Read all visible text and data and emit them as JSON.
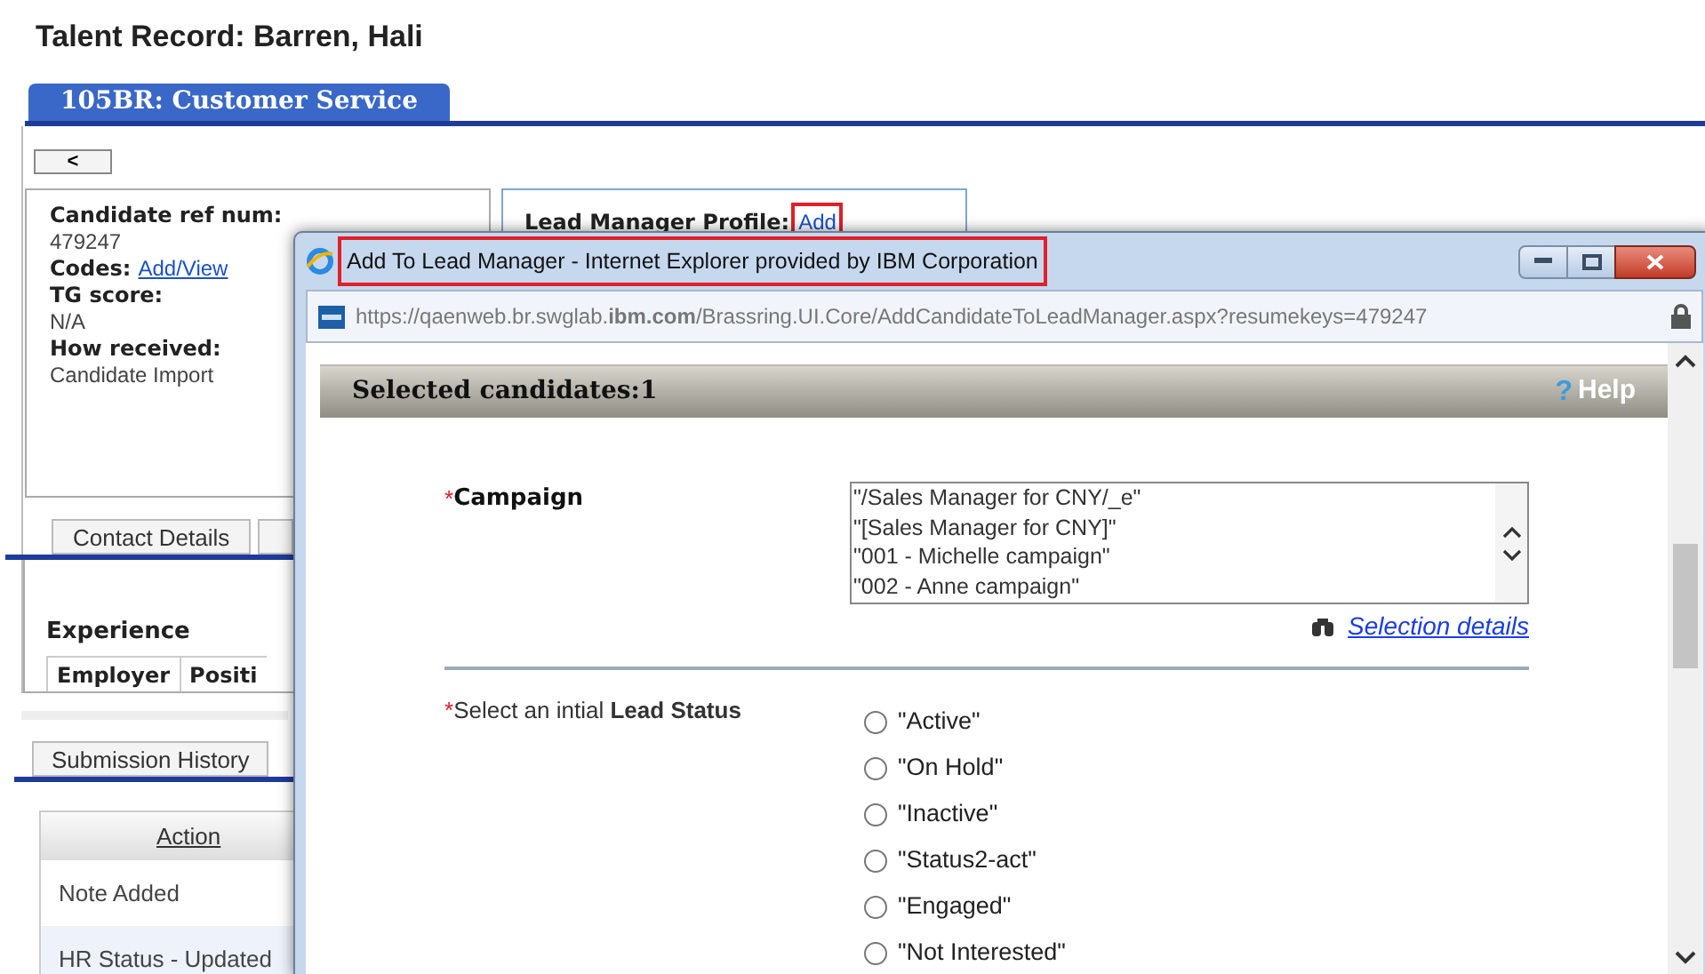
{
  "page_title": "Talent Record: Barren, Hali",
  "record_tabs": [
    {
      "label": "105BR: Customer Service",
      "selected": true
    }
  ],
  "back_button": {
    "label": "<"
  },
  "candidate_fields": [
    {
      "kind": "text",
      "label": "Candidate ref num:",
      "value": "479247"
    },
    {
      "kind": "link",
      "label": "Codes:",
      "value": "Add/View"
    },
    {
      "kind": "text",
      "label": "TG score:",
      "value": "N/A"
    },
    {
      "kind": "text",
      "label": "How received:",
      "value": "Candidate Import"
    }
  ],
  "lead_manager": {
    "label": "Lead Manager Profile:",
    "link": "Add"
  },
  "detail_tabs": [
    {
      "label": "Contact Details"
    }
  ],
  "experience": {
    "title": "Experience",
    "columns": [
      "Employer",
      "Positi"
    ]
  },
  "history_tabs": [
    {
      "label": "Submission History"
    }
  ],
  "history_table": {
    "columns": [
      "Action"
    ],
    "rows": [
      "Note Added",
      "HR Status - Updated"
    ]
  },
  "popup": {
    "title": "Add To Lead Manager - Internet Explorer provided by IBM Corporation",
    "url": "https://qaenweb.br.swglab.**ibm.com**/Brassring.UI.Core/AddCandidateToLeadManager.aspx?resumekeys=479247",
    "header": "Selected candidates:1",
    "help_mark": "?",
    "help": "Help",
    "campaign": {
      "required_mark": "*",
      "label": "Campaign",
      "options": [
        "\"/Sales Manager for CNY/_e\"",
        "\"[Sales Manager for CNY]\"",
        "\"001 - Michelle campaign\"",
        "\"002 - Anne campaign\""
      ],
      "link": "Selection details"
    },
    "lead_status": {
      "required_mark": "*",
      "label": "Select an intial **Lead Status**",
      "options": [
        {
          "label": "\"Active\"",
          "selected": false
        },
        {
          "label": "\"On Hold\"",
          "selected": false
        },
        {
          "label": "\"Inactive\"",
          "selected": false
        },
        {
          "label": "\"Status2-act\"",
          "selected": false
        },
        {
          "label": "\"Engaged\"",
          "selected": false
        },
        {
          "label": "\"Not Interested\"",
          "selected": false
        }
      ]
    }
  }
}
